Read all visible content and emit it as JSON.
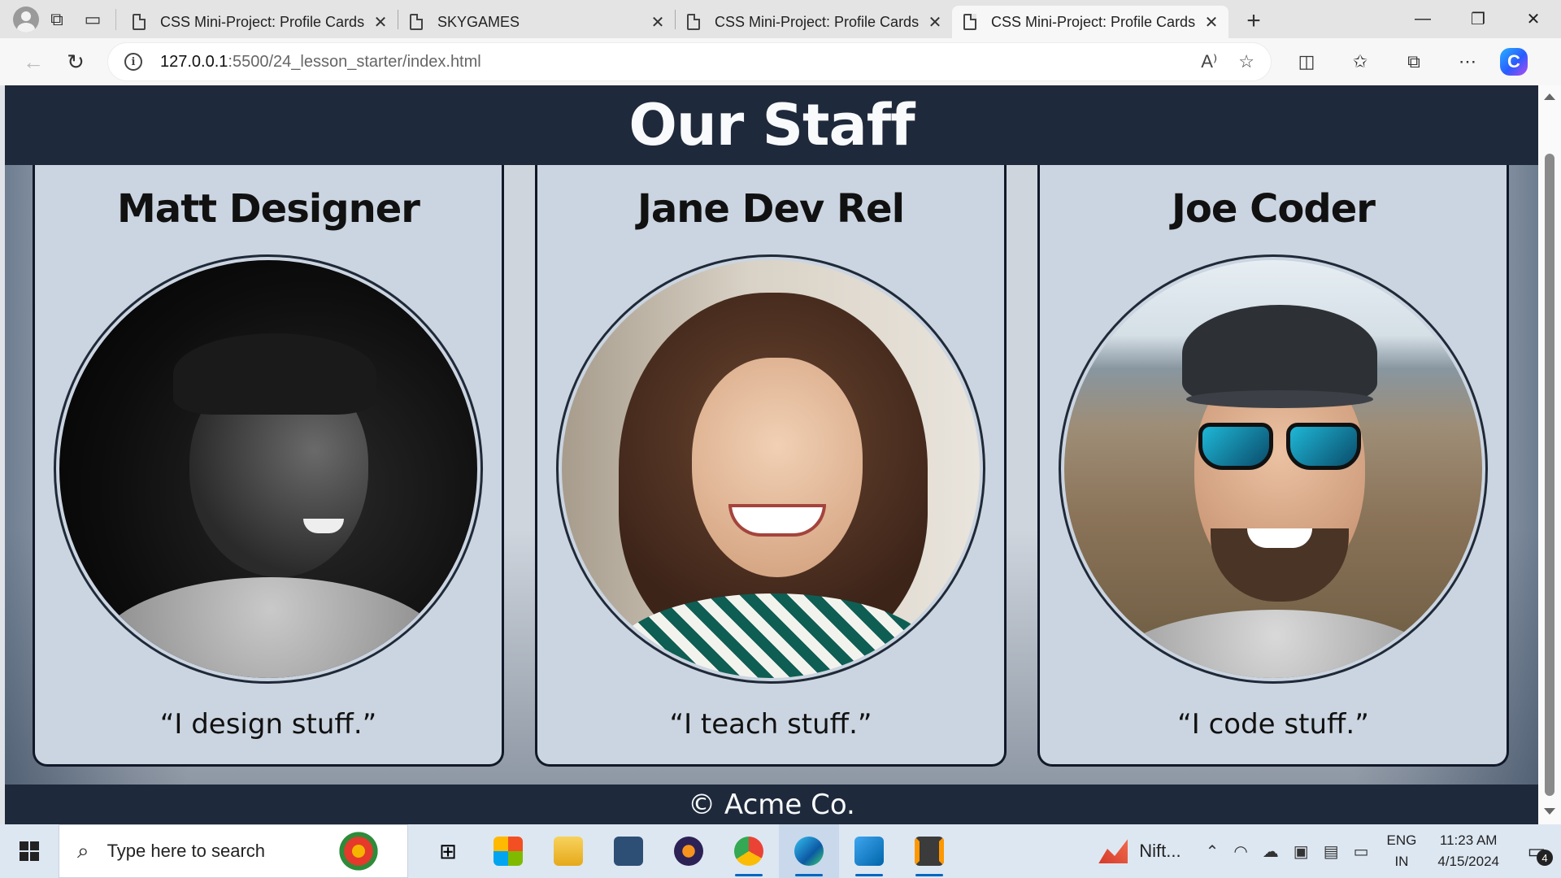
{
  "browser": {
    "tabs": [
      {
        "title": "CSS Mini-Project: Profile Cards",
        "active": false
      },
      {
        "title": "SKYGAMES",
        "active": false
      },
      {
        "title": "CSS Mini-Project: Profile Cards",
        "active": false
      },
      {
        "title": "CSS Mini-Project: Profile Cards",
        "active": true
      }
    ],
    "address": {
      "host": "127.0.0.1",
      "path": ":5500/24_lesson_starter/index.html"
    }
  },
  "page": {
    "title": "Our Staff",
    "cards": [
      {
        "name": "Matt Designer",
        "quote": "“I design stuff.”"
      },
      {
        "name": "Jane Dev Rel",
        "quote": "“I teach stuff.”"
      },
      {
        "name": "Joe Coder",
        "quote": "“I code stuff.”"
      }
    ],
    "footer": "© Acme Co."
  },
  "taskbar": {
    "search_placeholder": "Type here to search",
    "tray_app": "Nift...",
    "lang_line1": "ENG",
    "lang_line2": "IN",
    "time": "11:23 AM",
    "date": "4/15/2024",
    "notification_count": "4"
  },
  "colors": {
    "header_bg": "#1e293b",
    "card_bg": "#cbd5e1",
    "accent": "#0067c0"
  }
}
